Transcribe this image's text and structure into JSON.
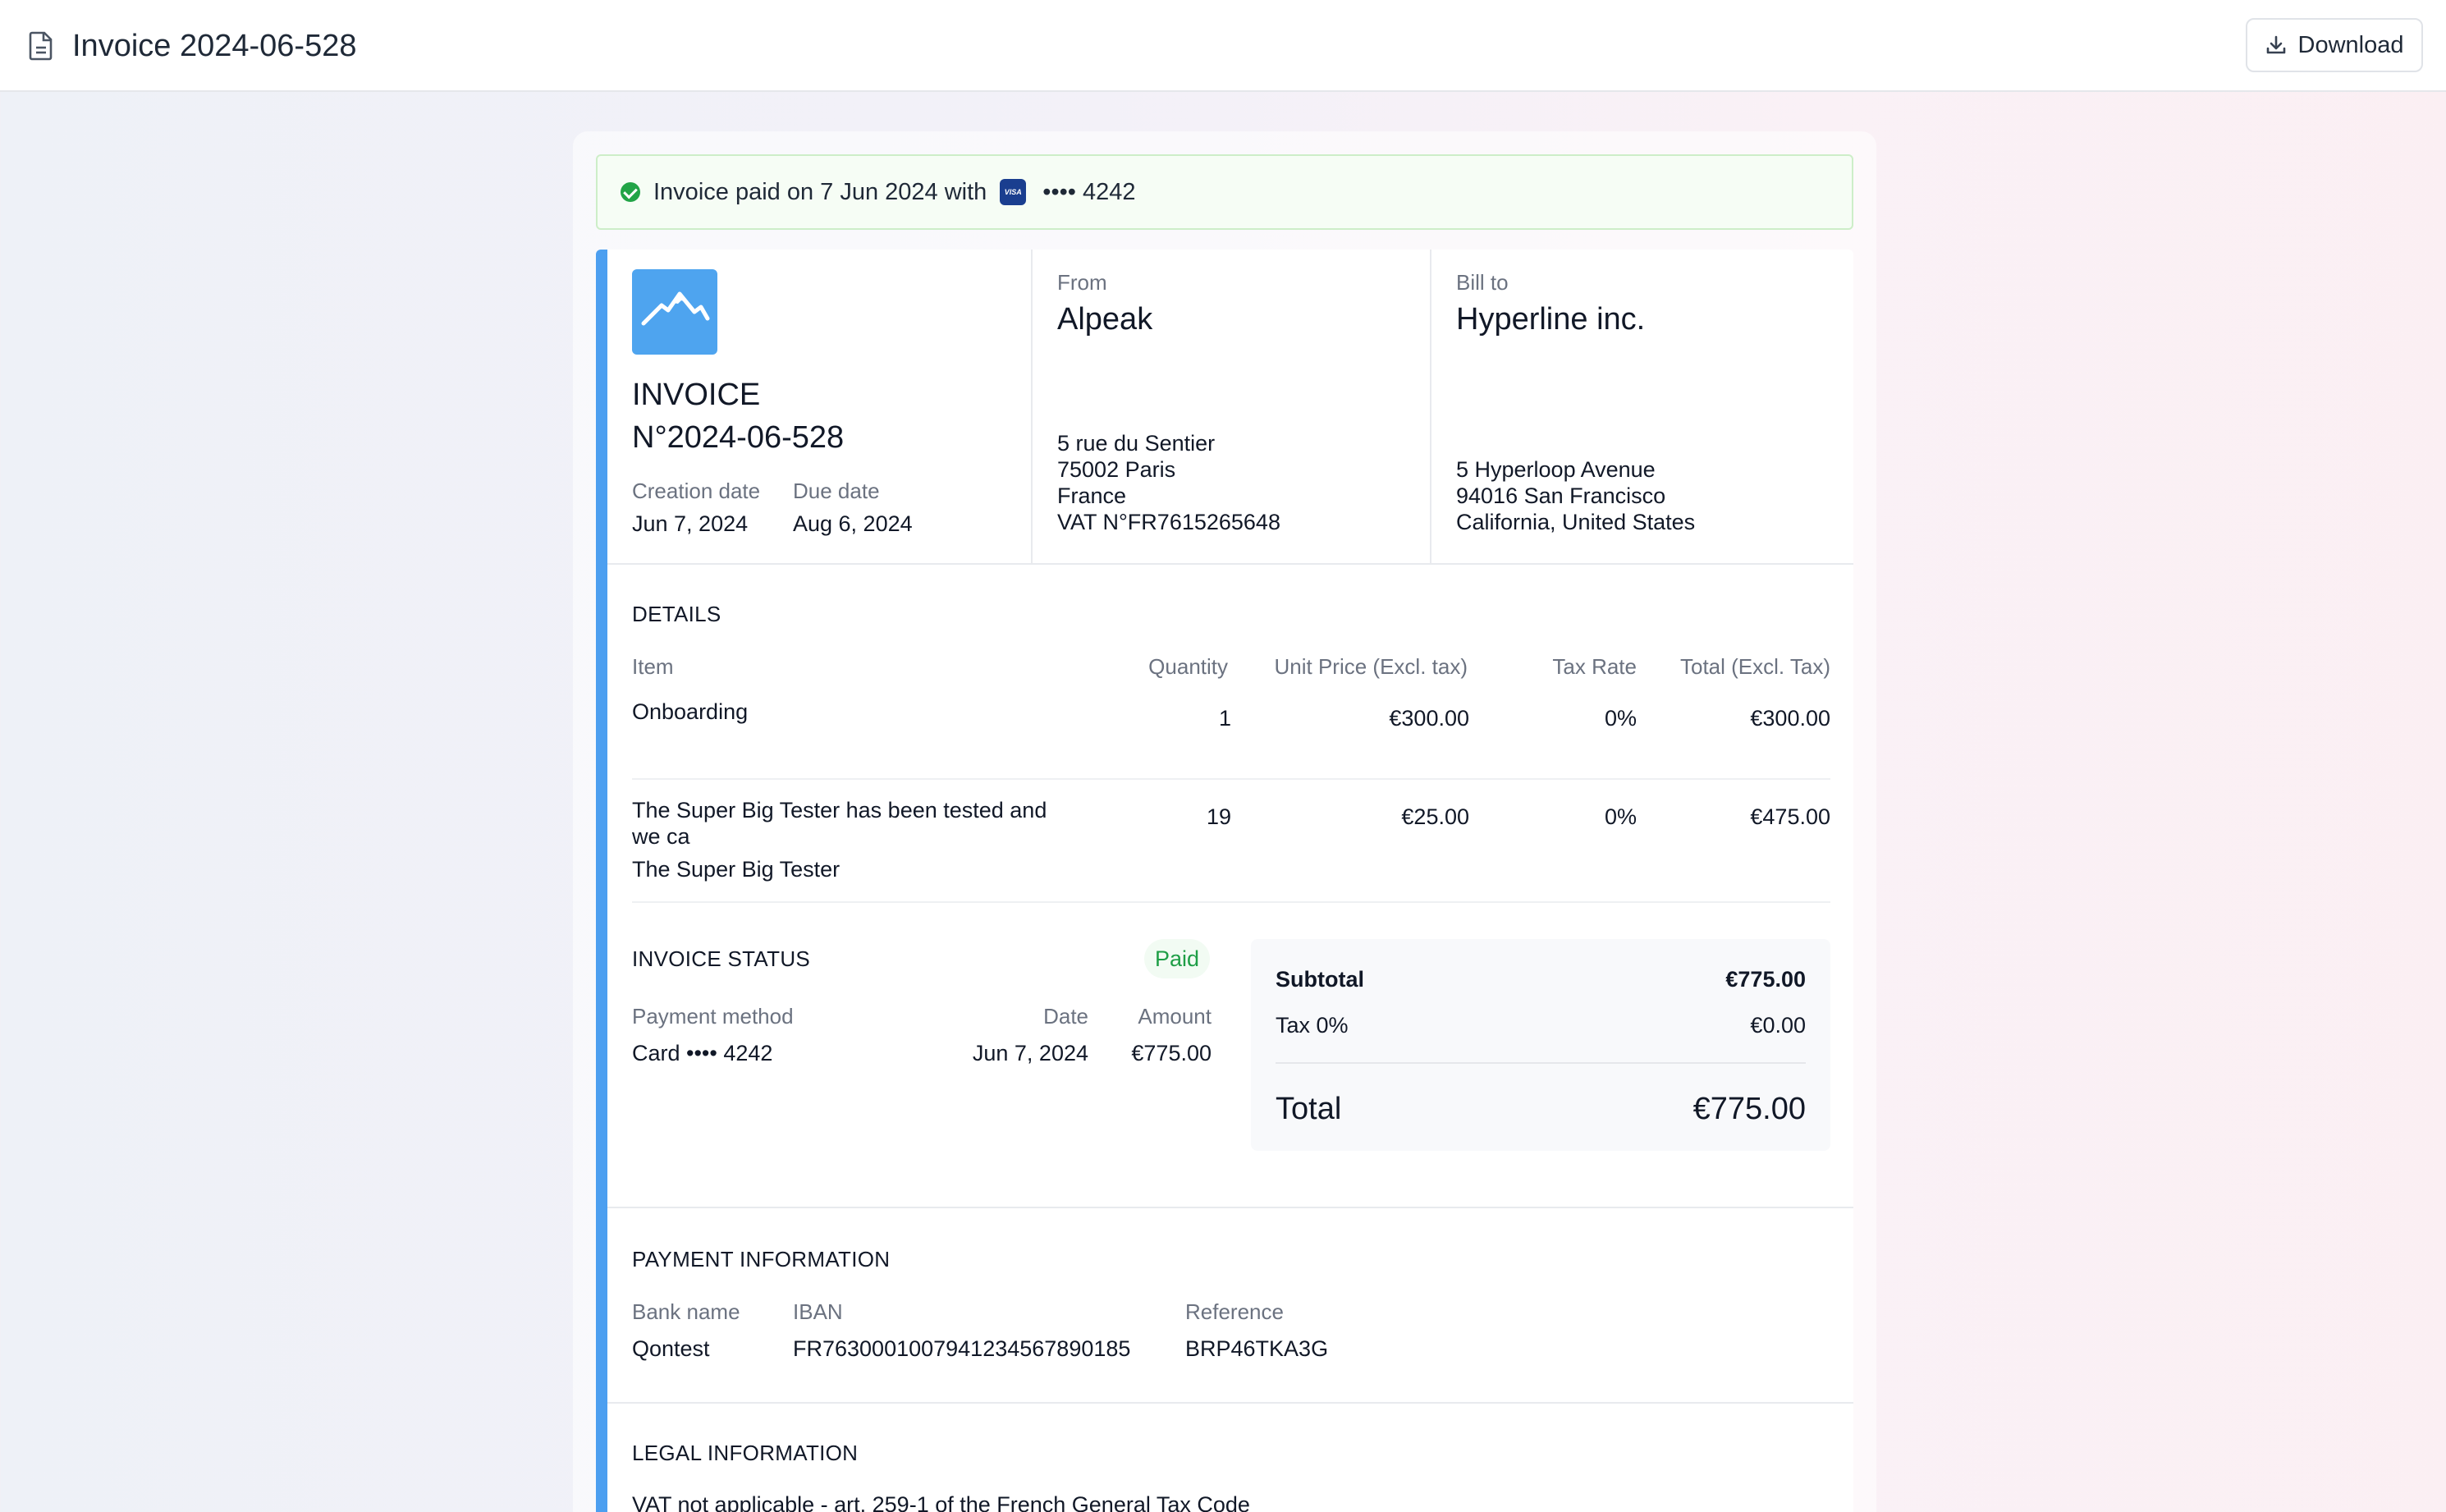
{
  "header": {
    "title": "Invoice 2024-06-528",
    "download_label": "Download"
  },
  "banner": {
    "text": "Invoice paid on 7 Jun 2024 with",
    "card_brand": "VISA",
    "card_masked": "•••• 4242"
  },
  "invoice": {
    "title": "INVOICE",
    "number": "N°2024-06-528",
    "creation_label": "Creation date",
    "creation_value": "Jun 7, 2024",
    "due_label": "Due date",
    "due_value": "Aug 6, 2024"
  },
  "from": {
    "label": "From",
    "name": "Alpeak",
    "address": [
      "5 rue du Sentier",
      "75002 Paris",
      "France",
      "VAT N°FR7615265648"
    ]
  },
  "bill_to": {
    "label": "Bill to",
    "name": "Hyperline inc.",
    "address": [
      "5 Hyperloop Avenue",
      "94016 San Francisco",
      "California, United States"
    ]
  },
  "details": {
    "title": "DETAILS",
    "columns": {
      "item": "Item",
      "quantity": "Quantity",
      "unit_price": "Unit Price (Excl. tax)",
      "tax_rate": "Tax Rate",
      "total": "Total (Excl. Tax)"
    },
    "rows": [
      {
        "name_line1": "Onboarding",
        "name_line2": "",
        "subtitle": "",
        "quantity": "1",
        "unit_price": "€300.00",
        "tax_rate": "0%",
        "total": "€300.00"
      },
      {
        "name_line1": "The Super Big Tester has been tested and",
        "name_line2": "we ca",
        "subtitle": "The Super Big Tester",
        "quantity": "19",
        "unit_price": "€25.00",
        "tax_rate": "0%",
        "total": "€475.00"
      }
    ]
  },
  "status": {
    "title": "INVOICE STATUS",
    "badge": "Paid",
    "col_method": "Payment method",
    "col_date": "Date",
    "col_amount": "Amount",
    "method": "Card •••• 4242",
    "date": "Jun 7, 2024",
    "amount": "€775.00"
  },
  "totals": {
    "subtotal_label": "Subtotal",
    "subtotal_value": "€775.00",
    "tax_label": "Tax 0%",
    "tax_value": "€0.00",
    "total_label": "Total",
    "total_value": "€775.00"
  },
  "payment": {
    "title": "PAYMENT INFORMATION",
    "bank_label": "Bank name",
    "bank_value": "Qontest",
    "iban_label": "IBAN",
    "iban_value": "FR7630001007941234567890185",
    "ref_label": "Reference",
    "ref_value": "BRP46TKA3G"
  },
  "legal": {
    "title": "LEGAL INFORMATION",
    "text": "VAT not applicable - art. 259-1 of the French General Tax Code"
  },
  "colors": {
    "accent": "#4c9ff0",
    "paid_green": "#22a447",
    "banner_bg": "#f6fdf5"
  },
  "icons": [
    "document-icon",
    "download-icon",
    "check-circle-icon",
    "visa-card-icon",
    "mountain-logo"
  ]
}
